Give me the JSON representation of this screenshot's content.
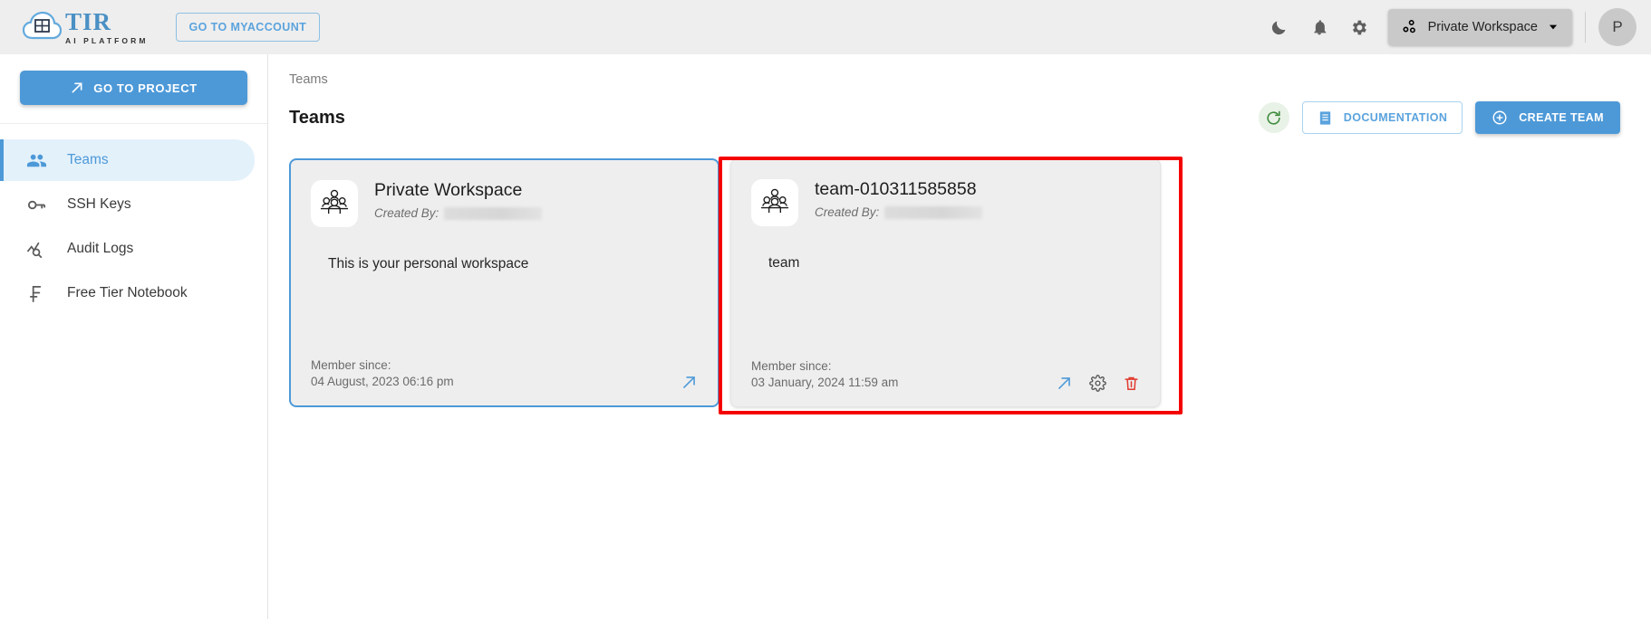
{
  "topbar": {
    "logo_title": "TIR",
    "logo_subtitle": "AI PLATFORM",
    "myaccount_label": "GO TO MYACCOUNT",
    "dark_mode_icon": "moon-icon",
    "notifications_icon": "bell-icon",
    "settings_icon": "gear-icon",
    "workspace_icon": "workspace-nodes-icon",
    "workspace_label": "Private Workspace",
    "workspace_caret": "chevron-down-icon",
    "avatar_initial": "P"
  },
  "sidebar": {
    "project_button": "GO TO PROJECT",
    "project_button_icon": "arrow-up-right-icon",
    "items": [
      {
        "label": "Teams",
        "icon": "groups-icon",
        "active": true
      },
      {
        "label": "SSH Keys",
        "icon": "key-icon",
        "active": false
      },
      {
        "label": "Audit Logs",
        "icon": "analytics-search-icon",
        "active": false
      },
      {
        "label": "Free Tier Notebook",
        "icon": "franc-f-icon",
        "active": false
      }
    ]
  },
  "main": {
    "breadcrumb": "Teams",
    "page_title": "Teams",
    "refresh_icon": "refresh-icon",
    "documentation_label": "DOCUMENTATION",
    "documentation_icon": "document-icon",
    "create_team_label": "CREATE TEAM",
    "create_team_icon": "plus-circle-icon"
  },
  "cards": [
    {
      "title": "Private Workspace",
      "icon": "team-group-icon",
      "created_by_label": "Created By:",
      "created_by_value": "",
      "description": "This is your personal workspace",
      "member_since_label": "Member since:",
      "member_since_value": "04 August, 2023 06:16 pm",
      "selected": true,
      "actions": [
        "open-arrow-icon"
      ]
    },
    {
      "title": "team-010311585858",
      "icon": "team-group-icon",
      "created_by_label": "Created By:",
      "created_by_value": "",
      "description": "team",
      "member_since_label": "Member since:",
      "member_since_value": "03 January, 2024 11:59 am",
      "selected": false,
      "actions": [
        "open-arrow-icon",
        "gear-icon",
        "trash-icon"
      ]
    }
  ],
  "annotation": {
    "highlight_color": "#f40000"
  }
}
